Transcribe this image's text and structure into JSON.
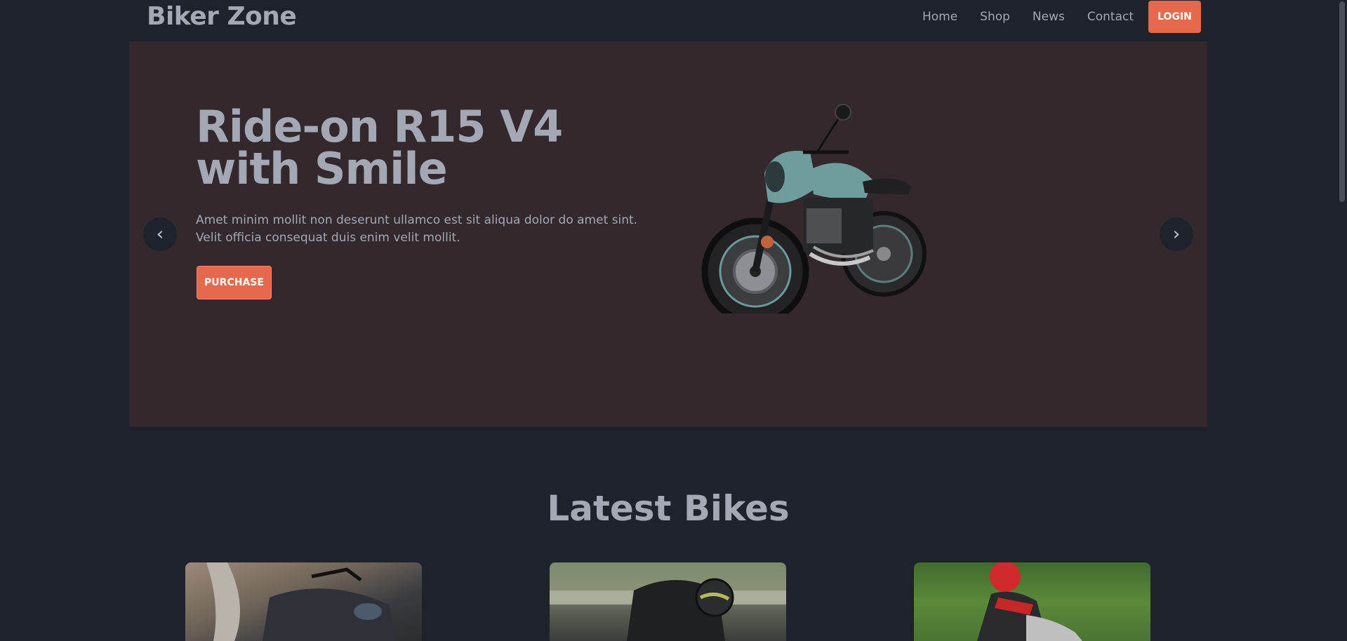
{
  "header": {
    "logo": "Biker Zone",
    "nav": [
      "Home",
      "Shop",
      "News",
      "Contact"
    ],
    "login_label": "LOGIN"
  },
  "hero": {
    "title_line1": "Ride-on R15 V4",
    "title_line2": "with Smile",
    "text": "Amet minim mollit non deserunt ullamco est sit aliqua dolor do amet sint. Velit officia consequat duis enim velit mollit.",
    "purchase_label": "PURCHASE",
    "prev_arrow": "‹",
    "next_arrow": "›"
  },
  "latest": {
    "title": "Latest Bikes"
  },
  "colors": {
    "background": "#1d222b",
    "hero_bg": "#33292d",
    "accent": "#e5694c",
    "text": "#a3a8b4"
  }
}
